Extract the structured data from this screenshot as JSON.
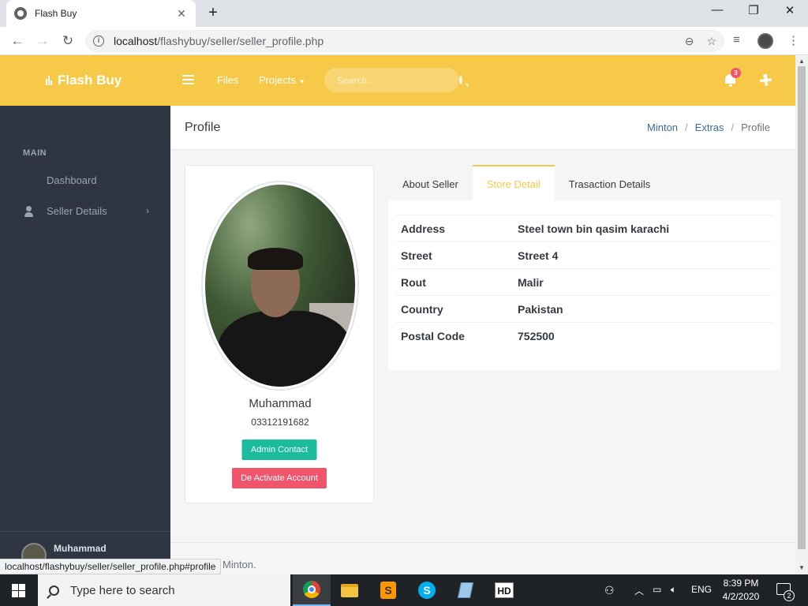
{
  "browser": {
    "tab_title": "Flash Buy",
    "url_host": "localhost",
    "url_path": "/flashybuy/seller/seller_profile.php",
    "status_url": "localhost/flashybuy/seller/seller_profile.php#profile"
  },
  "topbar": {
    "brand": "Flash Buy",
    "links": [
      "Files",
      "Projects"
    ],
    "search_placeholder": "Search...",
    "notification_count": "3"
  },
  "sidebar": {
    "menu_title": "MAIN",
    "items": [
      {
        "label": "Dashboard",
        "icon": "dashboard-icon"
      },
      {
        "label": "Seller Details",
        "icon": "user-icon"
      }
    ],
    "user_name": "Muhammad"
  },
  "page": {
    "title": "Profile",
    "breadcrumb": [
      "Minton",
      "Extras",
      "Profile"
    ]
  },
  "profile": {
    "name": "Muhammad",
    "phone": "03312191682",
    "admin_contact_label": "Admin Contact",
    "deactivate_label": "De Activate Account"
  },
  "tabs": [
    {
      "label": "About Seller",
      "active": false
    },
    {
      "label": "Store Detail",
      "active": true
    },
    {
      "label": "Trasaction Details",
      "active": false
    }
  ],
  "store_detail": [
    {
      "key": "Address",
      "value": "Steel town bin qasim karachi"
    },
    {
      "key": "Street",
      "value": "Street 4"
    },
    {
      "key": "Rout",
      "value": "Malir"
    },
    {
      "key": "Country",
      "value": "Pakistan"
    },
    {
      "key": "Postal Code",
      "value": "752500"
    }
  ],
  "footer": {
    "text": "Minton."
  },
  "taskbar": {
    "search_text": "Type here to search",
    "language": "ENG",
    "time": "8:39 PM",
    "date": "4/2/2020",
    "notifications": "2"
  },
  "colors": {
    "accent": "#f7c948",
    "sidebar_bg": "#2f3542",
    "success": "#1abc9c",
    "danger": "#f1556c"
  }
}
